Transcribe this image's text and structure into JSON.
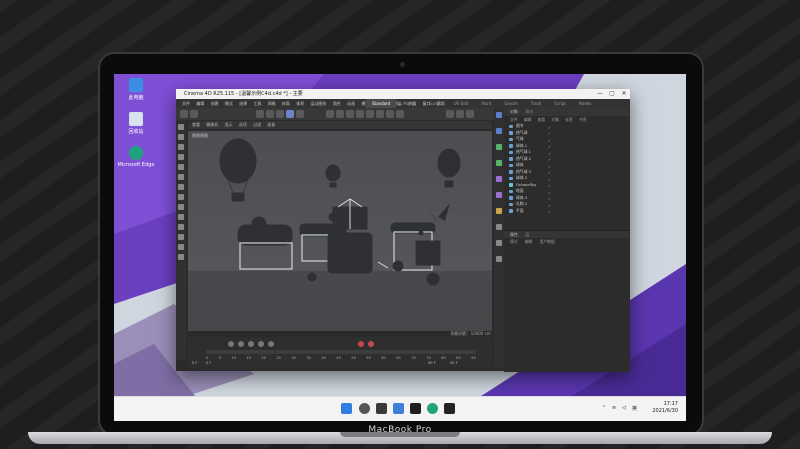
{
  "device": {
    "brand": "MacBook Pro"
  },
  "desktop": {
    "icons": [
      {
        "label": "此电脑",
        "color": "#3a8ee6"
      },
      {
        "label": "回收站",
        "color": "#d8e2ee"
      },
      {
        "label": "Microsoft Edge",
        "color": "#1fa37b"
      }
    ]
  },
  "app": {
    "title": "Cinema 4D R25.115 - [温馨示例C4d.c4d *] - 主要",
    "window_buttons": [
      "—",
      "▢",
      "✕"
    ],
    "menu": [
      "文件",
      "编辑",
      "创建",
      "模式",
      "选择",
      "工具",
      "网格",
      "样条",
      "体积",
      "运动图形",
      "角色",
      "动画",
      "模拟",
      "跟踪器",
      "渲染",
      "扩展",
      "窗口",
      "帮助"
    ],
    "layout_tabs": [
      "Standard",
      "Model",
      "Sculpt",
      "UV Edit",
      "Paint",
      "Groom",
      "Track",
      "Script",
      "Nodes"
    ],
    "active_tab": "Standard",
    "viewport": {
      "menu": [
        "查看",
        "摄像机",
        "显示",
        "选项",
        "过滤",
        "面板"
      ],
      "label": "透视视图",
      "status": "网格间距：10000 cm"
    },
    "timeline": {
      "ticks": [
        "0",
        "5",
        "10",
        "15",
        "20",
        "25",
        "30",
        "35",
        "40",
        "45",
        "50",
        "55",
        "60",
        "65",
        "70",
        "75",
        "80",
        "85",
        "90"
      ],
      "start": "0 F",
      "current": "0 F",
      "end": "90 F",
      "end_field": "90 F"
    },
    "object_manager": {
      "tabs": [
        "对象",
        "场次"
      ],
      "menu": [
        "文件",
        "编辑",
        "查看",
        "对象",
        "标签",
        "书签"
      ],
      "objects": [
        "细节",
        "热气球",
        "气球",
        "球体.1",
        "热气球.1",
        "热气球.2",
        "球体",
        "热气球.3",
        "球体.2",
        "OctaneSky",
        "地面",
        "球体.3",
        "礼物.1",
        "平面"
      ]
    },
    "attributes": {
      "tabs": [
        "属性",
        "层"
      ],
      "menu": [
        "模式",
        "编辑",
        "用户数据"
      ]
    }
  },
  "taskbar": {
    "time": "17:17",
    "date": "2021/6/30",
    "lang": "英"
  }
}
